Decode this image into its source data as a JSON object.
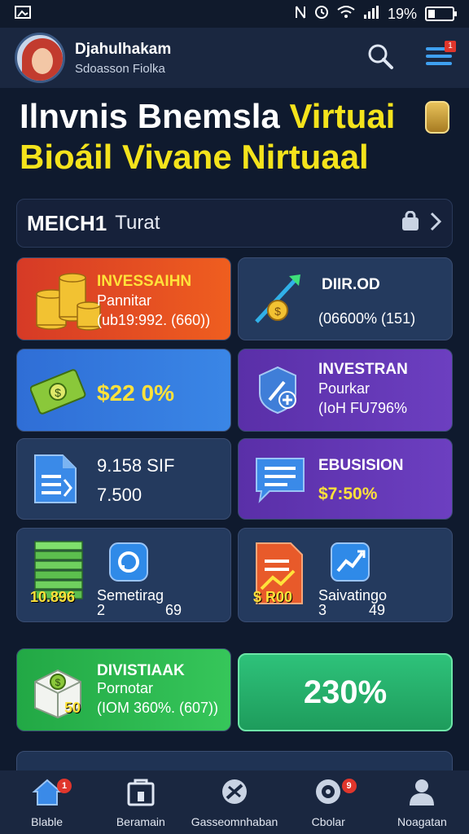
{
  "status_bar": {
    "battery": "19%"
  },
  "header": {
    "user_name": "Djahulhakam",
    "user_sub": "Sdoasson Fiolka",
    "menu_badge": "1"
  },
  "hero": {
    "line1_white": "Ilnvnis Bnemsla",
    "line1_yellow": "Virtuai",
    "line2": "Bioáil Vivane Nirtuaal"
  },
  "section": {
    "title": "MEICH1",
    "subtitle": "Turat"
  },
  "cards": [
    {
      "title": "INVESSAIHN",
      "line2": "Pannitar",
      "line3": "(ub19:992. (660))"
    },
    {
      "title": "DIIR.OD",
      "line2": "",
      "line3": "(06600% (151)"
    },
    {
      "title": "$22 0%"
    },
    {
      "title": "INVESTRAN",
      "line2": "Pourkar",
      "line3": "(IoH FU796%"
    },
    {
      "title": "9.158 SIF",
      "line2": "7.500"
    },
    {
      "title": "EBUSISION",
      "line2": "$7:50%"
    },
    {
      "badge": "10.896",
      "label": "Semetirag",
      "num1": "2",
      "num2": "69"
    },
    {
      "badge": "$ R00",
      "label": "Saivatingo",
      "num1": "3",
      "num2": "49"
    },
    {
      "title": "DIVISTIAAK",
      "line2": "Pornotar",
      "line3": "(IOM 360%. (607))",
      "badge": "50"
    },
    {
      "value": "230%"
    }
  ],
  "bottom_peek": "...",
  "nav": [
    {
      "label": "Blable",
      "badge": "1",
      "icon": "home-icon"
    },
    {
      "label": "Beramain",
      "icon": "store-icon"
    },
    {
      "label": "Gasseomnhaban",
      "icon": "tool-icon"
    },
    {
      "label": "Cbolar",
      "badge": "9",
      "icon": "target-icon"
    },
    {
      "label": "Noagatan",
      "icon": "profile-icon"
    }
  ],
  "colors": {
    "background": "#0f1a2e",
    "accent_yellow": "#f4e31c",
    "card_red": "#d63a26",
    "card_blue": "#2f6ed6",
    "card_purple": "#5a2fa8",
    "card_green": "#22a845",
    "card_dark": "#243a5e"
  }
}
